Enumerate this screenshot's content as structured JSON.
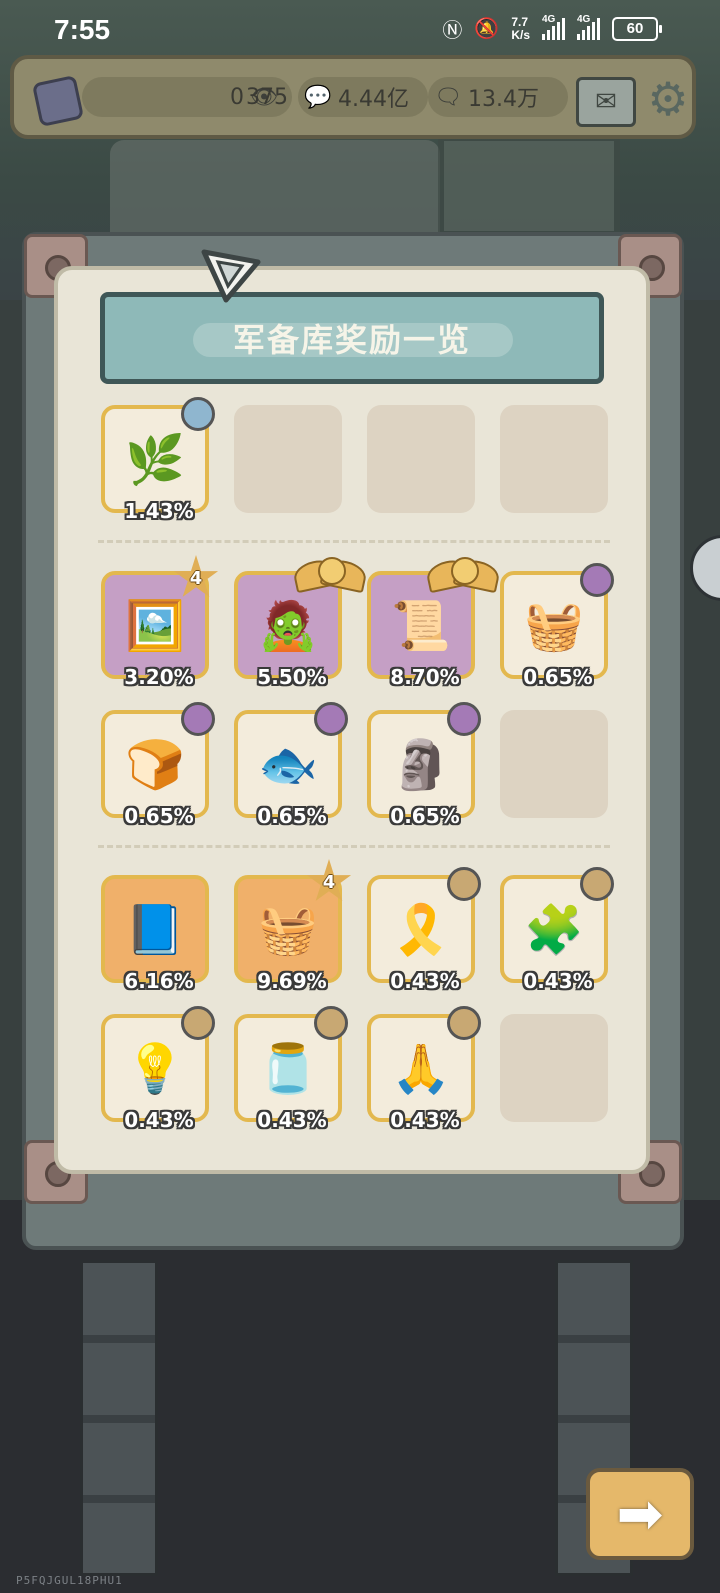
{
  "status_bar": {
    "time": "7:55",
    "speed_value": "7.7",
    "speed_unit": "K/s",
    "net1": "4G",
    "net2": "4G",
    "battery": "60"
  },
  "resources": {
    "eye_count": "0",
    "coin_count": "375",
    "speech_count": "4.44亿",
    "chat_count": "13.4万"
  },
  "panel": {
    "title": "军备库奖励一览"
  },
  "items": [
    {
      "pct": "1.43%",
      "art": "🌿",
      "badge": "blue",
      "bg": "plain"
    },
    {
      "pct": "3.20%",
      "art": "🖼️",
      "badge": "star",
      "star": "4",
      "bg": "purple"
    },
    {
      "pct": "5.50%",
      "art": "🧟",
      "badge": "wing",
      "bg": "purple"
    },
    {
      "pct": "8.70%",
      "art": "📜",
      "badge": "wing",
      "bg": "purple"
    },
    {
      "pct": "0.65%",
      "art": "🧺",
      "badge": "violet",
      "bg": "plain"
    },
    {
      "pct": "0.65%",
      "art": "🍞",
      "badge": "violet",
      "bg": "plain"
    },
    {
      "pct": "0.65%",
      "art": "🐟",
      "badge": "violet",
      "bg": "plain"
    },
    {
      "pct": "0.65%",
      "art": "🗿",
      "badge": "violet",
      "bg": "plain"
    },
    {
      "pct": "6.16%",
      "art": "📘",
      "badge": "none",
      "bg": "orange"
    },
    {
      "pct": "9.69%",
      "art": "🧺",
      "badge": "star",
      "star": "4",
      "bg": "orange"
    },
    {
      "pct": "0.43%",
      "art": "🎗️",
      "badge": "tan",
      "bg": "plain"
    },
    {
      "pct": "0.43%",
      "art": "🧩",
      "badge": "tan",
      "bg": "plain"
    },
    {
      "pct": "0.43%",
      "art": "💡",
      "badge": "tan",
      "bg": "plain"
    },
    {
      "pct": "0.43%",
      "art": "🫙",
      "badge": "tan",
      "bg": "plain"
    },
    {
      "pct": "0.43%",
      "art": "🙏",
      "badge": "tan",
      "bg": "plain"
    }
  ],
  "colors": {
    "panel_bg": "#e9e5d7",
    "slot_border": "#e3b84e",
    "rare_purple": "#c59fc5",
    "rare_orange": "#f0b06a",
    "title_banner": "#8eb9b8"
  },
  "icons": {
    "next": "arrow-right-icon",
    "mail": "mail-icon",
    "settings": "gear-icon"
  },
  "watermark": "P5FQJGUL18PHU1"
}
